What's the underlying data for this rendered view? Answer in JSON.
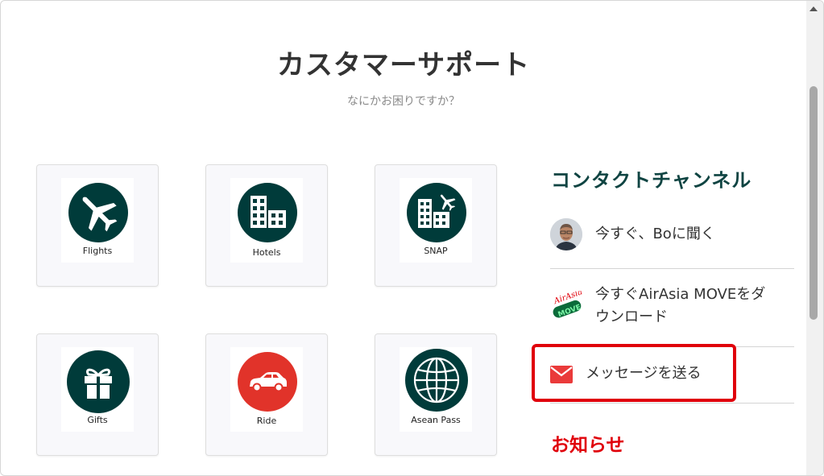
{
  "header": {
    "title": "カスタマーサポート",
    "subtitle": "なにかお困りですか？"
  },
  "categories": [
    {
      "label": "Flights",
      "icon": "airplane-icon"
    },
    {
      "label": "Hotels",
      "icon": "hotel-buildings-icon"
    },
    {
      "label": "SNAP",
      "icon": "snap-hotel-flight-icon"
    },
    {
      "label": "Gifts",
      "icon": "gift-icon"
    },
    {
      "label": "Ride",
      "icon": "car-icon"
    },
    {
      "label": "Asean Pass",
      "icon": "globe-icon"
    }
  ],
  "contact": {
    "title": "コンタクトチャンネル",
    "items": [
      {
        "label": "今すぐ、Boに聞く",
        "icon": "bo-avatar"
      },
      {
        "label_line1": "今すぐAirAsia MOVEをダ",
        "label_line2": "ウンロード",
        "icon": "airasia-move-logo",
        "logo_text_top": "AirAsia",
        "logo_text_bottom": "MOVE"
      },
      {
        "label": "メッセージを送る",
        "icon": "envelope-icon"
      }
    ]
  },
  "news": {
    "title": "お知らせ"
  },
  "colors": {
    "primary": "#003b3a",
    "heading": "#0f4442",
    "accent_red": "#e0000a",
    "ride_red": "#e1332a"
  }
}
